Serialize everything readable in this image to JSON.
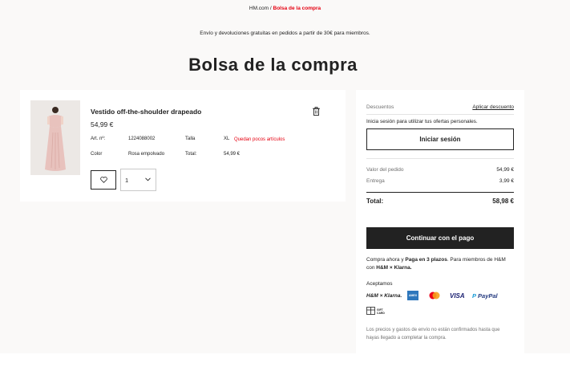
{
  "breadcrumb": {
    "home": "HM.com",
    "separator": " / ",
    "current": "Bolsa de la compra"
  },
  "promo": "Envío y devoluciones gratuitas en pedidos a partir de 30€ para miembros.",
  "page_title": "Bolsa de la compra",
  "item": {
    "name": "Vestido off-the-shoulder drapeado",
    "price": "54,99 €",
    "art_label": "Art. nº:",
    "art_value": "1224088002",
    "size_label": "Talla",
    "size_value": "XL",
    "stock_warning": "Quedan pocos artículos",
    "color_label": "Color",
    "color_value": "Rosa empolvado",
    "total_label": "Total:",
    "total_value": "54,99 €",
    "quantity": "1",
    "image_color": "#e8c2bd"
  },
  "summary": {
    "discounts_label": "Descuentos",
    "apply_discount": "Aplicar descuento",
    "login_prompt": "Inicia sesión para utilizar tus ofertas personales.",
    "login_button": "Iniciar sesión",
    "order_value_label": "Valor del pedido",
    "order_value": "54,99 €",
    "delivery_label": "Entrega",
    "delivery_value": "3,99 €",
    "total_label": "Total:",
    "total_value": "58,98 €",
    "checkout_button": "Continuar con el pago",
    "klarna_pre": "Compra ahora y ",
    "klarna_bold": "Paga en 3 plazos",
    "klarna_post": ". Para miembros de H&M con ",
    "klarna_brand": "H&M × Klarna.",
    "accepted_label": "Aceptamos",
    "payment_methods": [
      "H&M × Klarna.",
      "AMEX",
      "Mastercard",
      "VISA",
      "PayPal"
    ],
    "gift_card": "GIFT CARD",
    "disclaimer": "Los precios y gastos de envío no están confirmados hasta que hayas llegado a completar la compra."
  },
  "colors": {
    "accent_red": "#e50010",
    "dark": "#222222",
    "amex_blue": "#2e77bc",
    "paypal_blue": "#253b80",
    "visa_blue": "#1a1f71"
  }
}
